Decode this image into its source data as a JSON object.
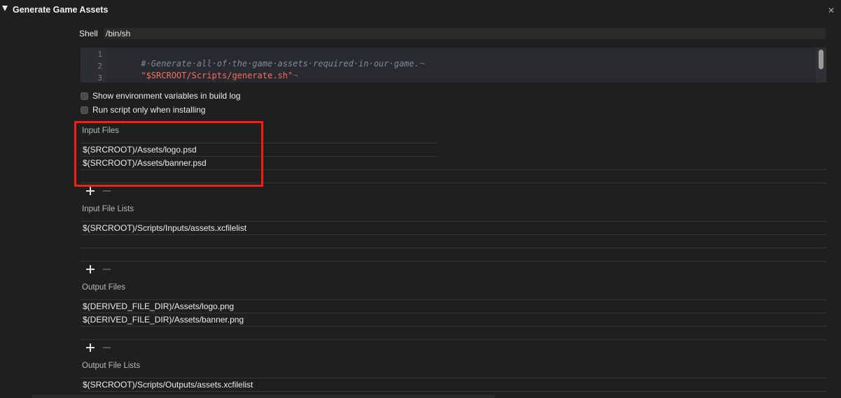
{
  "header": {
    "title": "Generate Game Assets",
    "close_glyph": "✕"
  },
  "shell": {
    "label": "Shell",
    "value": "/bin/sh"
  },
  "script": {
    "line_numbers": [
      "1",
      "2",
      "3"
    ],
    "lines": [
      {
        "text": "#·Generate·all·of·the·game·assets·required·in·our·game.",
        "eol": "¬"
      },
      {
        "text": "\"$SRCROOT/Scripts/generate.sh\"",
        "eol": "¬"
      },
      {
        "text": "",
        "eol": ""
      }
    ]
  },
  "options": {
    "show_env": {
      "label": "Show environment variables in build log",
      "checked": false
    },
    "run_installing": {
      "label": "Run script only when installing",
      "checked": false
    }
  },
  "input_files": {
    "title": "Input Files",
    "items": [
      "$(SRCROOT)/Assets/logo.psd",
      "$(SRCROOT)/Assets/banner.psd"
    ]
  },
  "input_file_lists": {
    "title": "Input File Lists",
    "items": [
      "$(SRCROOT)/Scripts/Inputs/assets.xcfilelist"
    ]
  },
  "output_files": {
    "title": "Output Files",
    "items": [
      "$(DERIVED_FILE_DIR)/Assets/logo.png",
      "$(DERIVED_FILE_DIR)/Assets/banner.png"
    ]
  },
  "output_file_lists": {
    "title": "Output File Lists",
    "items": [
      "$(SRCROOT)/Scripts/Outputs/assets.xcfilelist"
    ]
  },
  "colors": {
    "background": "#1f1f1f",
    "highlight": "#ef1f14",
    "string": "#fc6a5d",
    "comment": "#7f8c98"
  },
  "icons": {
    "add": "plus-icon",
    "remove": "minus-icon",
    "disclosure": "disclosure-triangle-icon",
    "close": "close-icon"
  }
}
